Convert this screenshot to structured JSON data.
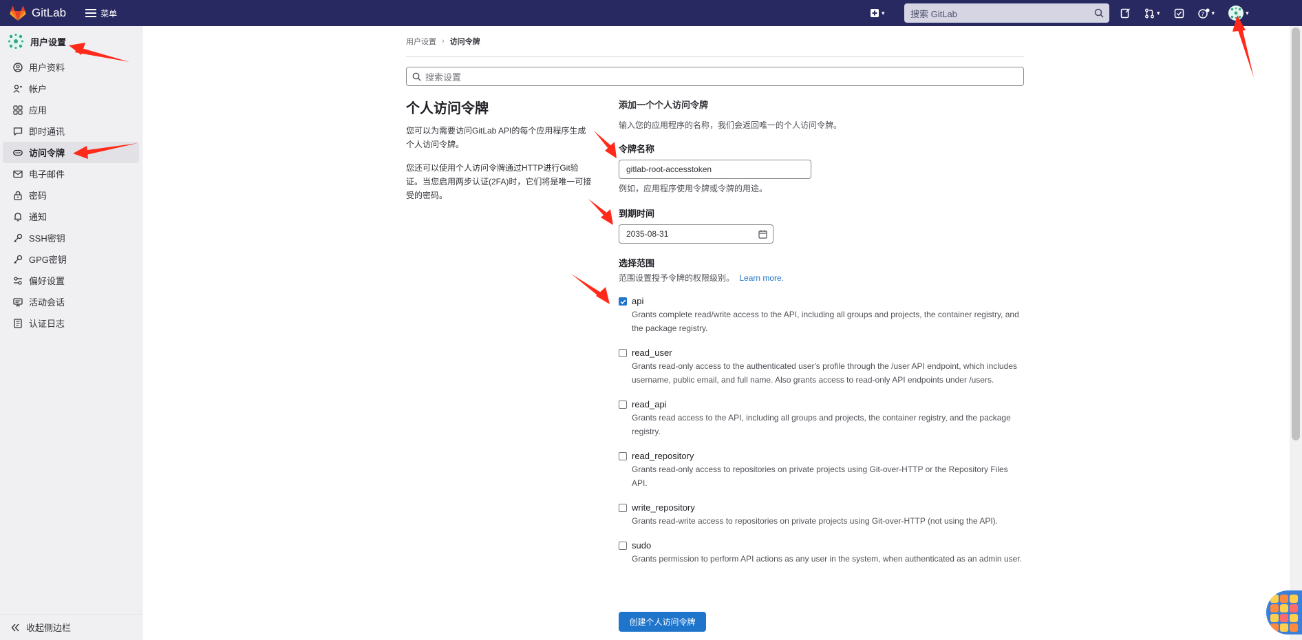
{
  "topbar": {
    "brand": "GitLab",
    "menu_label": "菜单",
    "search_placeholder": "搜索 GitLab",
    "icons": [
      "plus-square-icon",
      "search-icon",
      "issues-icon",
      "merge-request-icon",
      "todo-icon",
      "help-icon",
      "avatar"
    ]
  },
  "sidebar": {
    "title": "用户设置",
    "items": [
      {
        "label": "用户资料",
        "icon": "profile-icon"
      },
      {
        "label": "帐户",
        "icon": "account-icon"
      },
      {
        "label": "应用",
        "icon": "applications-icon"
      },
      {
        "label": "即时通讯",
        "icon": "chat-icon"
      },
      {
        "label": "访问令牌",
        "icon": "token-icon",
        "active": true
      },
      {
        "label": "电子邮件",
        "icon": "mail-icon"
      },
      {
        "label": "密码",
        "icon": "lock-icon"
      },
      {
        "label": "通知",
        "icon": "notification-icon"
      },
      {
        "label": "SSH密钥",
        "icon": "key-icon"
      },
      {
        "label": "GPG密钥",
        "icon": "key-icon"
      },
      {
        "label": "偏好设置",
        "icon": "preferences-icon"
      },
      {
        "label": "活动会话",
        "icon": "monitor-icon"
      },
      {
        "label": "认证日志",
        "icon": "log-icon"
      }
    ],
    "collapse_label": "收起侧边栏"
  },
  "breadcrumb": {
    "parent": "用户设置",
    "separator": "›",
    "current": "访问令牌"
  },
  "settings_search_placeholder": "搜索设置",
  "intro": {
    "title": "个人访问令牌",
    "p1": "您可以为需要访问GitLab API的每个应用程序生成个人访问令牌。",
    "p2": "您还可以使用个人访问令牌通过HTTP进行Git验证。当您启用两步认证(2FA)时，它们将是唯一可接受的密码。"
  },
  "form": {
    "heading": "添加一个个人访问令牌",
    "description": "输入您的应用程序的名称，我们会返回唯一的个人访问令牌。",
    "token_name_label": "令牌名称",
    "token_name_value": "gitlab-root-accesstoken",
    "token_name_help": "例如，应用程序使用令牌或令牌的用途。",
    "expires_label": "到期时间",
    "expires_value": "2035-08-31",
    "scopes_label": "选择范围",
    "scopes_help": "范围设置授予令牌的权限级别。",
    "learn_more": "Learn more.",
    "scopes": [
      {
        "name": "api",
        "checked": true,
        "description": "Grants complete read/write access to the API, including all groups and projects, the container registry, and the package registry."
      },
      {
        "name": "read_user",
        "checked": false,
        "description": "Grants read-only access to the authenticated user's profile through the /user API endpoint, which includes username, public email, and full name. Also grants access to read-only API endpoints under /users."
      },
      {
        "name": "read_api",
        "checked": false,
        "description": "Grants read access to the API, including all groups and projects, the container registry, and the package registry."
      },
      {
        "name": "read_repository",
        "checked": false,
        "description": "Grants read-only access to repositories on private projects using Git-over-HTTP or the Repository Files API."
      },
      {
        "name": "write_repository",
        "checked": false,
        "description": "Grants read-write access to repositories on private projects using Git-over-HTTP (not using the API)."
      },
      {
        "name": "sudo",
        "checked": false,
        "description": "Grants permission to perform API actions as any user in the system, when authenticated as an admin user."
      }
    ],
    "submit_label": "创建个人访问令牌"
  },
  "colors": {
    "navbar": "#292961",
    "sidebar": "#f0f0f2",
    "primary": "#1f75cb",
    "annotation_arrow": "#ff2a1a"
  }
}
